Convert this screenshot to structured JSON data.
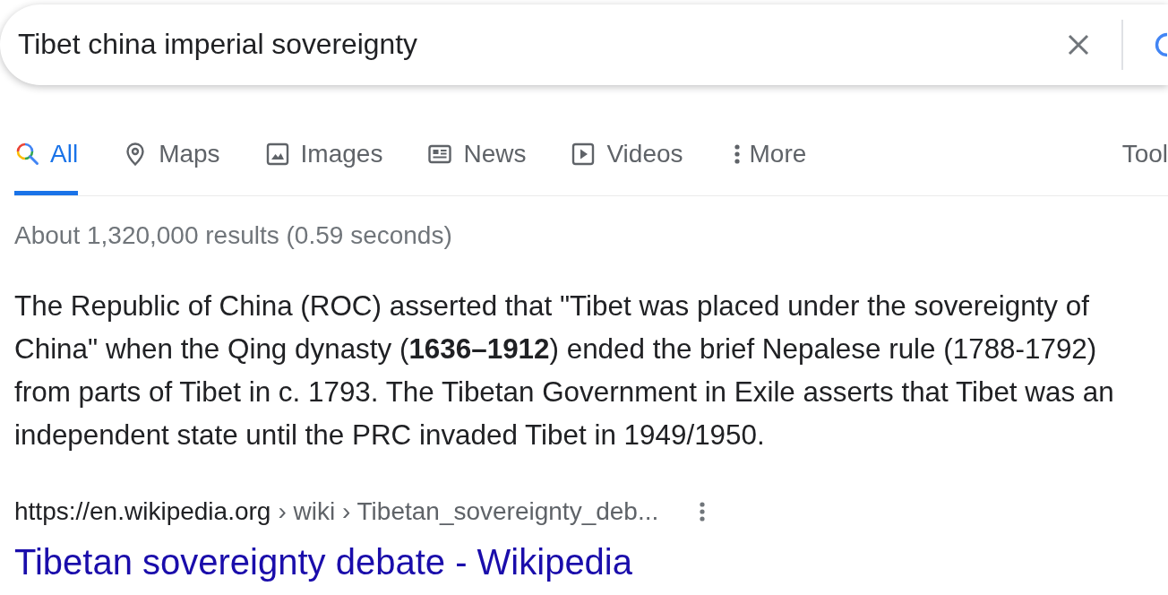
{
  "search": {
    "query": "Tibet china imperial sovereignty"
  },
  "tabs": [
    {
      "label": "All",
      "kind": "all",
      "selected": true
    },
    {
      "label": "Maps",
      "kind": "maps",
      "selected": false
    },
    {
      "label": "Images",
      "kind": "images",
      "selected": false
    },
    {
      "label": "News",
      "kind": "news",
      "selected": false
    },
    {
      "label": "Videos",
      "kind": "videos",
      "selected": false
    },
    {
      "label": "More",
      "kind": "more",
      "selected": false
    }
  ],
  "tools": {
    "label": "Tool"
  },
  "result_stats": "About 1,320,000 results (0.59 seconds)",
  "featured_snippet": {
    "text": "The Republic of China (ROC) asserted that \"Tibet was placed under the sovereignty of China\" when the Qing dynasty (**1636–1912**) ended the brief Nepalese rule (1788-1792) from parts of Tibet in c. 1793. The Tibetan Government in Exile asserts that Tibet was an independent state until the PRC invaded Tibet in 1949/1950."
  },
  "result": {
    "url": "https://en.wikipedia.org",
    "breadcrumb": "› wiki › Tibetan_sovereignty_deb...",
    "title": "Tibetan sovereignty debate - Wikipedia"
  }
}
